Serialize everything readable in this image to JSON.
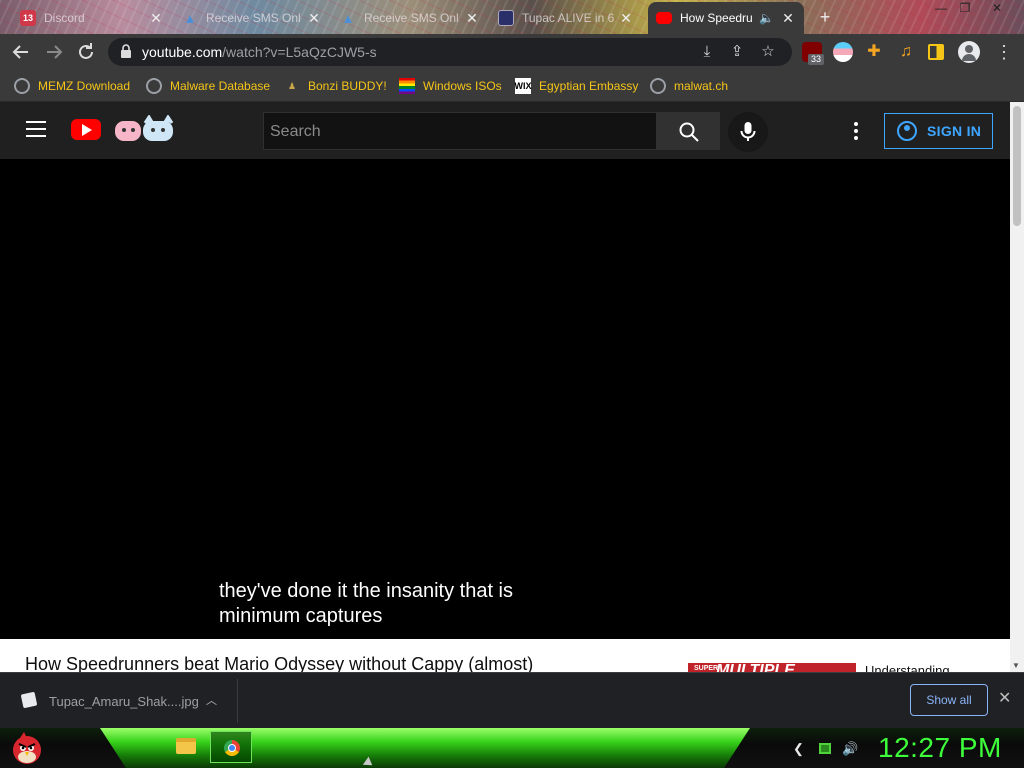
{
  "browser": {
    "tabs": [
      {
        "title": "Discord",
        "badge": "13",
        "active": false
      },
      {
        "title": "Receive SMS Onl",
        "active": false
      },
      {
        "title": "Receive SMS Onl",
        "active": false
      },
      {
        "title": "Tupac ALIVE in 6",
        "active": false
      },
      {
        "title": "How Speedru",
        "active": true
      }
    ],
    "new_tab_label": "+",
    "url_host": "youtube.com",
    "url_path": "/watch?v=L5aQzCJW5-s",
    "extension_badge": "33"
  },
  "bookmarks": [
    {
      "label": "MEMZ Download",
      "icon": "globe-icon"
    },
    {
      "label": "Malware Database",
      "icon": "globe-icon"
    },
    {
      "label": "Bonzi BUDDY!",
      "icon": "bonzi-icon"
    },
    {
      "label": "Windows ISOs",
      "icon": "rainbow-flag-icon"
    },
    {
      "label": "Egyptian Embassy",
      "icon": "wix-icon",
      "icon_text": "WIX"
    },
    {
      "label": "malwat.ch",
      "icon": "globe-icon"
    }
  ],
  "youtube": {
    "search_placeholder": "Search",
    "sign_in_label": "SIGN IN",
    "captions": [
      "they've done it the insanity that is",
      "minimum captures"
    ],
    "video_title": "How Speedrunners beat Mario Odyssey without Cappy (almost)",
    "recommended": {
      "thumb_text": "MULTIPLE",
      "thumb_small": "SUPER",
      "title": "Understanding"
    }
  },
  "downloads": {
    "file_name": "Tupac_Amaru_Shak....jpg",
    "show_all_label": "Show all"
  },
  "taskbar": {
    "clock": "12:27 PM"
  },
  "colors": {
    "accent_blue": "#3ea6ff",
    "bookmark_text": "#f5c518",
    "clock_green": "#3dff3a",
    "youtube_red": "#ff0000"
  }
}
